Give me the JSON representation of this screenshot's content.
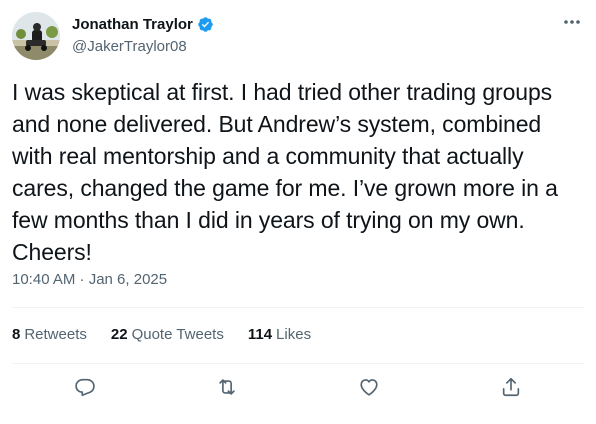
{
  "author": {
    "display_name": "Jonathan Traylor",
    "handle": "@JakerTraylor08",
    "verified": true,
    "avatar_icon": "profile-avatar-icon"
  },
  "tweet": {
    "text": "I was skeptical at first. I had tried other trading groups and none delivered. But Andrew’s system, combined with real mentorship and a community that actually cares, changed the game for me. I’ve grown more in a few months than I did in years of trying on my own. Cheers!",
    "timestamp": "10:40 AM · Jan 6, 2025"
  },
  "stats": {
    "retweets_count": "8",
    "retweets_label": "Retweets",
    "quote_count": "22",
    "quote_label": "Quote Tweets",
    "likes_count": "114",
    "likes_label": "Likes"
  },
  "actions": {
    "reply_icon": "reply-icon",
    "retweet_icon": "retweet-icon",
    "like_icon": "heart-icon",
    "share_icon": "share-icon",
    "more_icon": "more-icon"
  },
  "colors": {
    "text_primary": "#0f1419",
    "text_secondary": "#536471",
    "verified_blue": "#1d9bf0",
    "divider": "#eff3f4"
  }
}
